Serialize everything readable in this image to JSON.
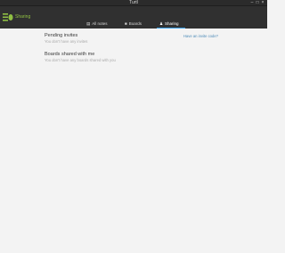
{
  "window": {
    "title": "Turtl"
  },
  "header": {
    "section": "Sharing",
    "accent_color": "#8fbf43",
    "tabs": [
      {
        "label": "All notes",
        "icon": "notes-icon"
      },
      {
        "label": "Boards",
        "icon": "boards-icon"
      },
      {
        "label": "Sharing",
        "icon": "sharing-icon",
        "active": true
      }
    ],
    "active_underline_color": "#3aa0e8"
  },
  "main": {
    "invite_link": "Have an invite code?",
    "pending": {
      "heading": "Pending invites",
      "empty": "You don't have any invites"
    },
    "shared": {
      "heading": "Boards shared with me",
      "empty": "You don't have any boards shared with you"
    }
  }
}
